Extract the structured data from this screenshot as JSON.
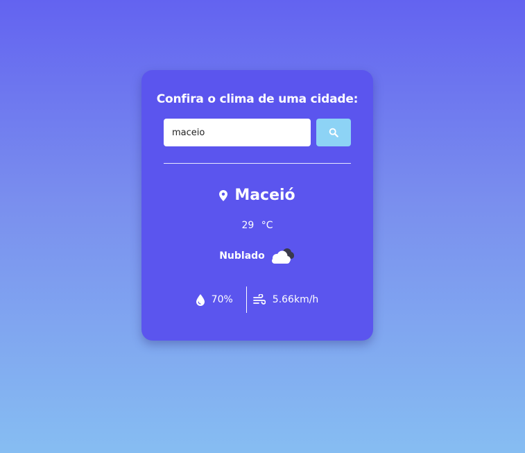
{
  "card": {
    "title": "Confira o clima de uma cidade:"
  },
  "search": {
    "value": "maceio",
    "placeholder": "",
    "button_icon": "search-icon"
  },
  "weather": {
    "city": "Maceió",
    "city_icon": "map-pin-icon",
    "temperature": "29",
    "unit": "°C",
    "description": "Nublado",
    "description_icon": "cloudy-icon",
    "humidity": "70%",
    "humidity_icon": "water-drop-icon",
    "wind": "5.66km/h",
    "wind_icon": "wind-icon"
  },
  "colors": {
    "card_background": "#5b55ee",
    "search_button": "#8dd3f5",
    "gradient_top": "#6363f0",
    "gradient_bottom": "#86bdf2"
  }
}
